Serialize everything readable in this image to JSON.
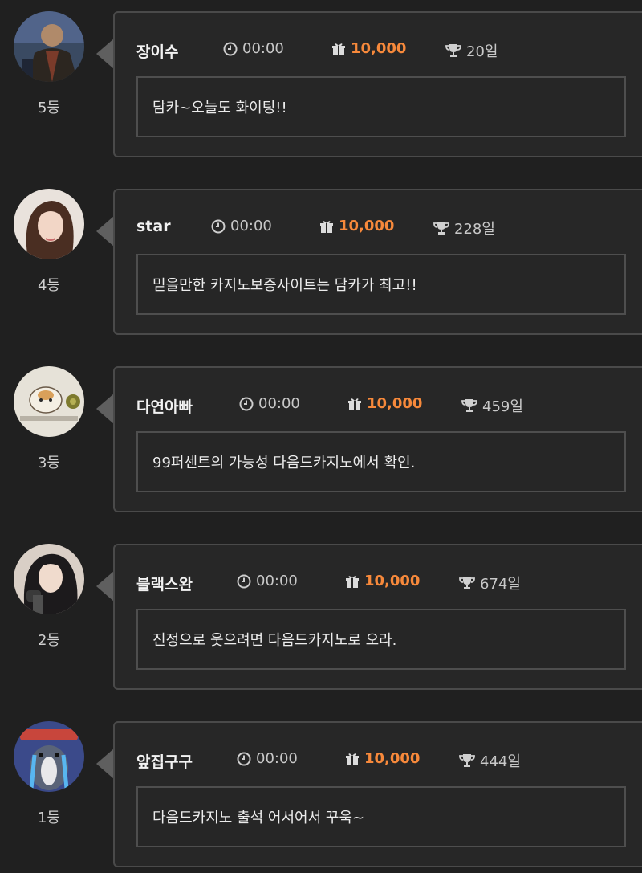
{
  "entries": [
    {
      "rank": "5등",
      "name": "장이수",
      "time": "00:00",
      "reward": "10,000",
      "days": "20일",
      "message": "담카~오늘도 화이팅!!",
      "avatar": "man-in-coat-avatar"
    },
    {
      "rank": "4등",
      "name": "star",
      "time": "00:00",
      "reward": "10,000",
      "days": "228일",
      "message": "믿을만한 카지노보증사이트는 담카가 최고!!",
      "avatar": "woman-portrait-avatar"
    },
    {
      "rank": "3등",
      "name": "다연아빠",
      "time": "00:00",
      "reward": "10,000",
      "days": "459일",
      "message": "99퍼센트의 가능성 다음드카지노에서 확인.",
      "avatar": "hamster-drawing-avatar"
    },
    {
      "rank": "2등",
      "name": "블랙스완",
      "time": "00:00",
      "reward": "10,000",
      "days": "674일",
      "message": "진정으로 웃으려면 다음드카지노로 오라.",
      "avatar": "woman-microphone-avatar"
    },
    {
      "rank": "1등",
      "name": "앞집구구",
      "time": "00:00",
      "reward": "10,000",
      "days": "444일",
      "message": "다음드카지노 출석 어서어서 꾸욱~",
      "avatar": "crying-bird-avatar"
    }
  ],
  "colors": {
    "background": "#202020",
    "card_border": "#4a4a4a",
    "reward_accent": "#f7893b",
    "text": "#e6e6e6"
  },
  "icons": [
    "clock-icon",
    "gift-icon",
    "trophy-icon"
  ]
}
